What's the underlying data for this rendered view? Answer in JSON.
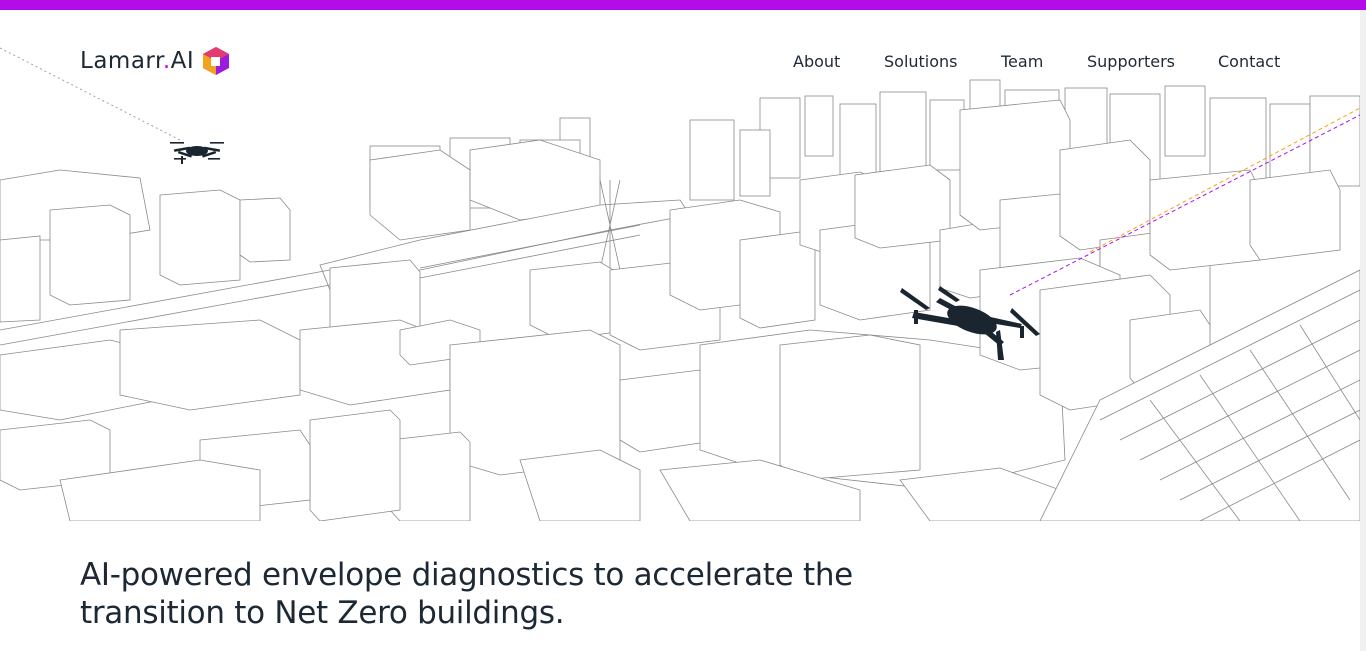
{
  "brand": {
    "name": "Lamarr",
    "dot": ".",
    "suffix": "AI",
    "accent": "#b40ce8",
    "logo_mark_colors": [
      "#f3a21c",
      "#e53a6e",
      "#9b1ce0"
    ]
  },
  "nav": {
    "items": [
      {
        "label": "About"
      },
      {
        "label": "Solutions"
      },
      {
        "label": "Team"
      },
      {
        "label": "Supporters"
      },
      {
        "label": "Contact"
      }
    ]
  },
  "hero": {
    "illustration": "city-wireframe-with-drones",
    "icons": [
      "drone-icon",
      "drone-icon"
    ],
    "line_colors": [
      "#f3a21c",
      "#b40ce8"
    ]
  },
  "tagline": {
    "line1": "AI-powered envelope diagnostics to accelerate the",
    "line2": "transition to Net Zero buildings."
  }
}
